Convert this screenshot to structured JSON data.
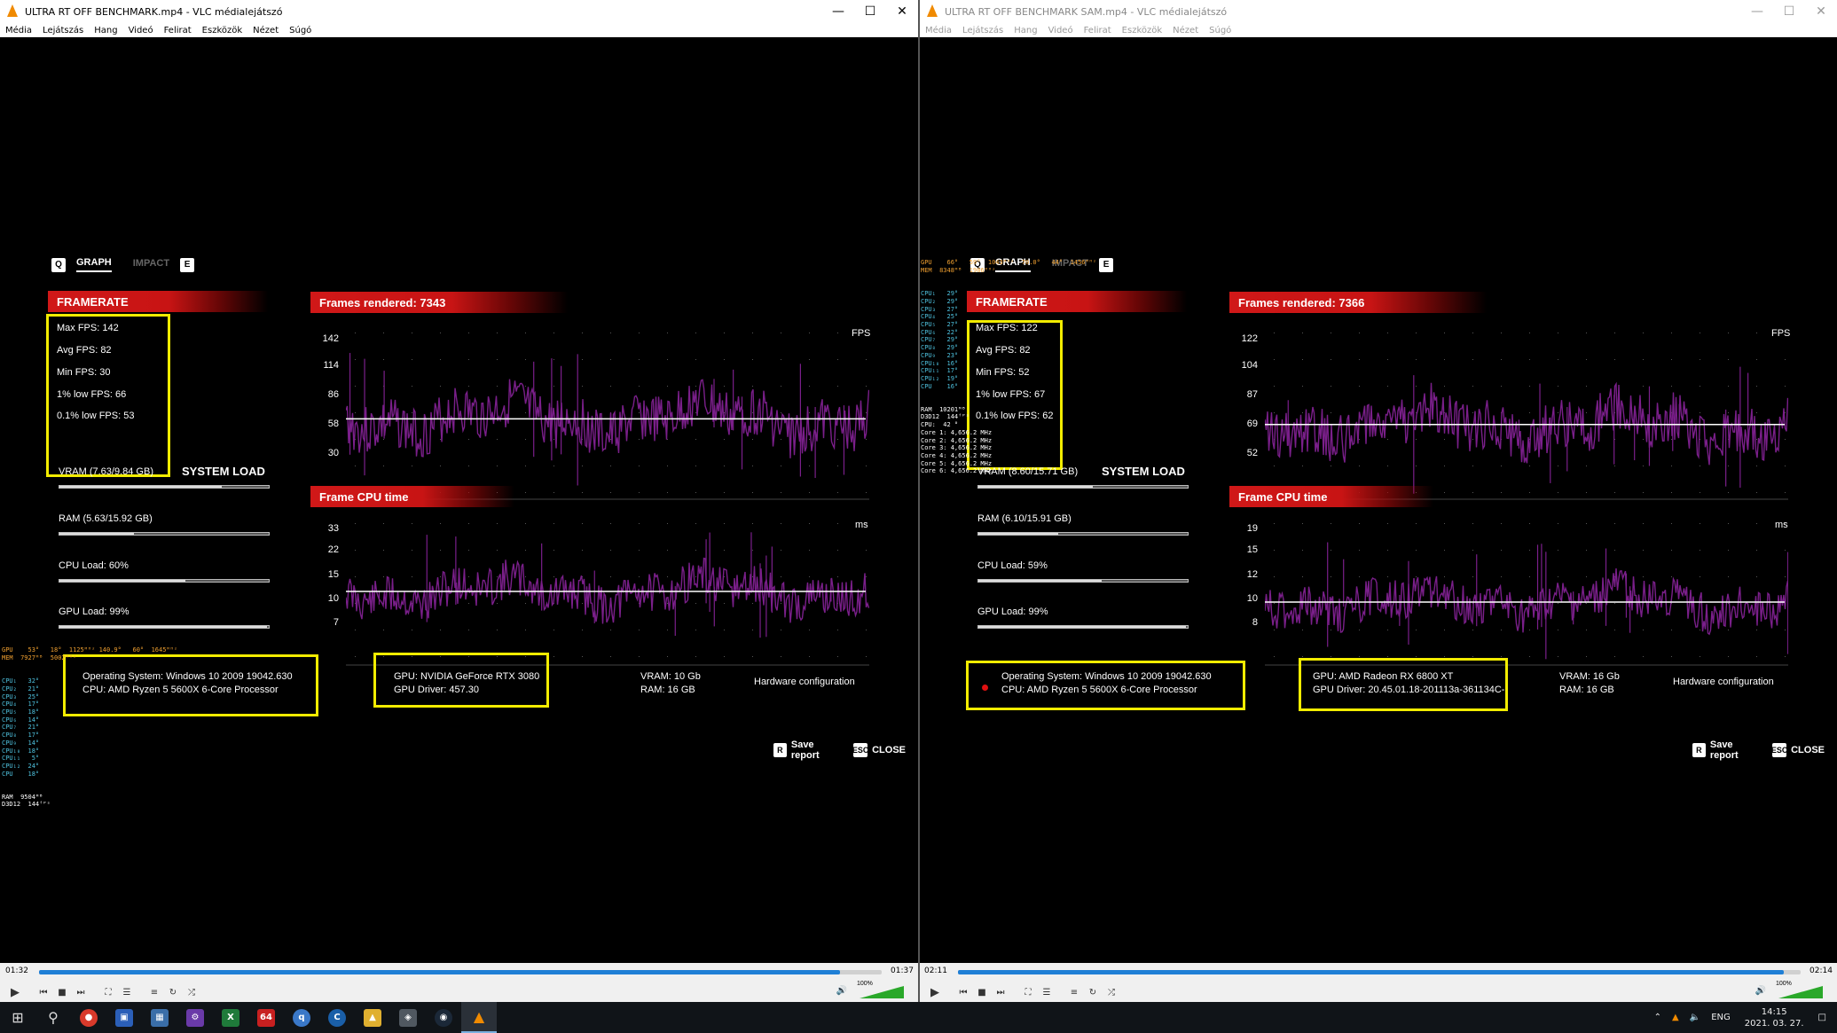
{
  "windows": [
    {
      "id": "left",
      "title": "ULTRA RT OFF BENCHMARK.mp4 - VLC médialejátszó",
      "menu": [
        "Média",
        "Lejátszás",
        "Hang",
        "Videó",
        "Felirat",
        "Eszközök",
        "Nézet",
        "Súgó"
      ],
      "tabs": {
        "q_key": "Q",
        "graph": "GRAPH",
        "impact": "IMPACT",
        "e_key": "E"
      },
      "framerate_label": "FRAMERATE",
      "fps_stats": [
        "Max FPS: 142",
        "Avg FPS: 82",
        "Min FPS: 30",
        "1% low FPS: 66",
        "0.1% low FPS: 53"
      ],
      "system_load_title": "SYSTEM LOAD",
      "loads": [
        {
          "label": "VRAM (7.63/9.84 GB)",
          "fraction": 0.775
        },
        {
          "label": "RAM (5.63/15.92 GB)",
          "fraction": 0.354
        },
        {
          "label": "CPU Load: 60%",
          "fraction": 0.6
        },
        {
          "label": "GPU Load: 99%",
          "fraction": 0.99
        }
      ],
      "frames_rendered": "Frames rendered: 7343",
      "fps_unit": "FPS",
      "fps_ticks": [
        "142",
        "114",
        "86",
        "58",
        "30"
      ],
      "fps_range": [
        30,
        142
      ],
      "fps_avg": 82,
      "cpu_label": "Frame CPU time",
      "ms_unit": "ms",
      "ms_ticks": [
        "33",
        "22",
        "15",
        "10",
        "7"
      ],
      "ms_level": 0.5,
      "os_line": "Operating System: Windows 10 2009 19042.630",
      "cpu_line": "CPU: AMD Ryzen 5 5600X 6-Core Processor",
      "gpu_line": "GPU: NVIDIA GeForce RTX 3080",
      "driver_line": "GPU Driver: 457.30",
      "vram_line": "VRAM: 10 Gb",
      "ram_line": "RAM: 16 GB",
      "hw_config": "Hardware configuration",
      "save_key": "R",
      "save_label": "Save report",
      "close_key": "ESC",
      "close_label": "CLOSE",
      "time_elapsed": "01:32",
      "time_total": "01:37",
      "progress": 0.95,
      "volume": "100%"
    },
    {
      "id": "right",
      "title": "ULTRA RT OFF BENCHMARK SAM.mp4 - VLC médialejátszó",
      "menu": [
        "Média",
        "Lejátszás",
        "Hang",
        "Videó",
        "Felirat",
        "Eszközök",
        "Nézet",
        "Súgó"
      ],
      "tabs": {
        "q_key": "Q",
        "graph": "GRAPH",
        "impact": "IMPACT",
        "e_key": "E"
      },
      "framerate_label": "FRAMERATE",
      "fps_stats": [
        "Max FPS: 122",
        "Avg FPS: 82",
        "Min FPS: 52",
        "1% low FPS: 67",
        "0.1% low FPS: 62"
      ],
      "system_load_title": "SYSTEM LOAD",
      "loads": [
        {
          "label": "VRAM (8.60/15.71 GB)",
          "fraction": 0.547
        },
        {
          "label": "RAM (6.10/15.91 GB)",
          "fraction": 0.383
        },
        {
          "label": "CPU Load: 59%",
          "fraction": 0.59
        },
        {
          "label": "GPU Load: 99%",
          "fraction": 0.99
        }
      ],
      "frames_rendered": "Frames rendered: 7366",
      "fps_unit": "FPS",
      "fps_ticks": [
        "122",
        "104",
        "87",
        "69",
        "52"
      ],
      "fps_range": [
        52,
        122
      ],
      "fps_avg": 82,
      "cpu_label": "Frame CPU time",
      "ms_unit": "ms",
      "ms_ticks": [
        "19",
        "15",
        "12",
        "10",
        "8"
      ],
      "ms_level": 0.58,
      "os_line": "Operating System: Windows 10 2009 19042.630",
      "cpu_line": "CPU: AMD Ryzen 5 5600X 6-Core Processor",
      "gpu_line": "GPU: AMD Radeon RX 6800 XT",
      "driver_line": "GPU Driver: 20.45.01.18-201113a-361134C-",
      "vram_line": "VRAM: 16 Gb",
      "ram_line": "RAM: 16 GB",
      "hw_config": "Hardware configuration",
      "save_key": "R",
      "save_label": "Save report",
      "close_key": "ESC",
      "close_label": "CLOSE",
      "time_elapsed": "02:11",
      "time_total": "02:14",
      "progress": 0.98,
      "volume": "100%"
    }
  ],
  "overlay_left": {
    "top": "GPU    53°   18°  1125ᴹᴴᶻ 140.9°   60°  1645ᴹᴴᶻ\nMEM  7927ᴹᴮ  5002ᴹᴴᶻ",
    "cpu": "CPU₁   32°\nCPU₂   21°\nCPU₃   25°\nCPU₄   17°\nCPU₅   18°\nCPU₆   14°\nCPU₇   21°\nCPU₈   17°\nCPU₉   14°\nCPU₁₀  18°\nCPU₁₁   5°\nCPU₁₂  24°\nCPU    18°",
    "bottom": "RAM  9504ᴹᴮ\nD3D12  144ᶠᴾˢ"
  },
  "overlay_right": {
    "top": "GPU    66°   59°  1043ᴹᴴᶻ  70.0°   44°  1456ᴹᴴᶻ\nMEM  8348ᴹᴮ  1986ᴹᴴᶻ",
    "cpu": "CPU₁   29°\nCPU₂   29°\nCPU₃   27°\nCPU₄   25°\nCPU₅   27°\nCPU₆   22°\nCPU₇   29°\nCPU₈   29°\nCPU₉   23°\nCPU₁₀  16°\nCPU₁₁  17°\nCPU₁₂  19°\nCPU    16°",
    "bottom": "RAM  10201ᴹᴮ\nD3D12  144ᶠᴾˢ\nCPU:  42 °\nCore 1: 4,656.2 MHz\nCore 2: 4,656.2 MHz\nCore 3: 4,656.2 MHz\nCore 4: 4,656.2 MHz\nCore 5: 4,656.2 MHz\nCore 6: 4,656.2 MHz"
  },
  "taskbar": {
    "language": "ENG",
    "time": "14:15",
    "date": "2021. 03. 27."
  },
  "colors": {
    "accent_red": "#d01818",
    "highlight_yellow": "#f2ec00",
    "graph_purple": "#7a1f8a",
    "vlc_orange": "#f08a00",
    "seek_blue": "#1f7fd6"
  }
}
